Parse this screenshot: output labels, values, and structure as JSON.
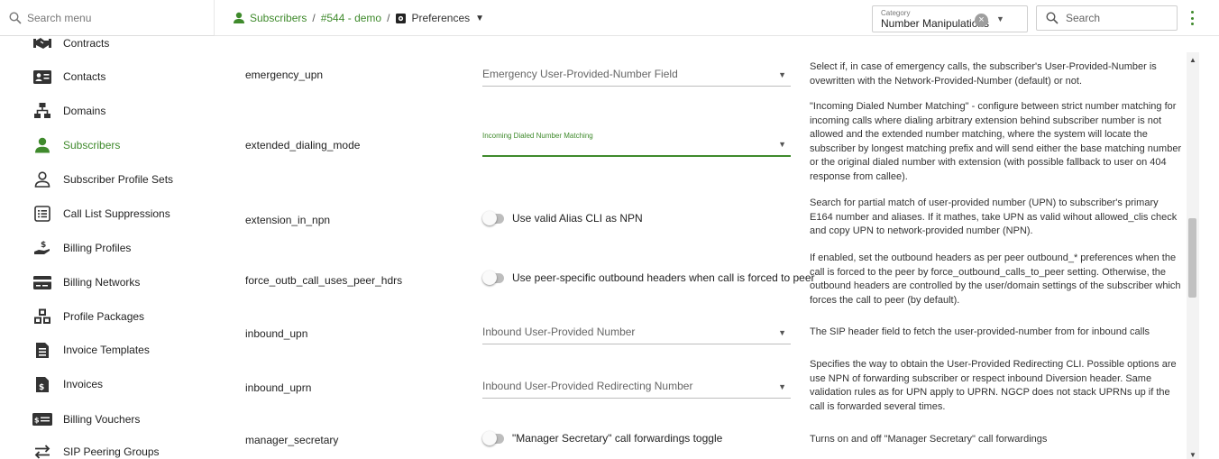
{
  "menu_search": {
    "placeholder": "Search menu"
  },
  "breadcrumb": {
    "items": [
      "Subscribers",
      "#544 - demo",
      "Preferences"
    ]
  },
  "category": {
    "label": "Category",
    "value": "Number Manipulations"
  },
  "search": {
    "placeholder": "Search"
  },
  "colors": {
    "accent": "#3f8a2c",
    "text": "#222222"
  },
  "sidebar": {
    "items": [
      {
        "label": "Contracts",
        "icon": "handshake-icon"
      },
      {
        "label": "Contacts",
        "icon": "contact-card-icon"
      },
      {
        "label": "Domains",
        "icon": "sitemap-icon"
      },
      {
        "label": "Subscribers",
        "icon": "person-icon",
        "active": true
      },
      {
        "label": "Subscriber Profile Sets",
        "icon": "person-outline-icon"
      },
      {
        "label": "Call List Suppressions",
        "icon": "list-box-icon"
      },
      {
        "label": "Billing Profiles",
        "icon": "hand-coin-icon"
      },
      {
        "label": "Billing Networks",
        "icon": "card-icon"
      },
      {
        "label": "Profile Packages",
        "icon": "cubes-icon"
      },
      {
        "label": "Invoice Templates",
        "icon": "document-icon"
      },
      {
        "label": "Invoices",
        "icon": "invoice-dollar-icon"
      },
      {
        "label": "Billing Vouchers",
        "icon": "voucher-icon"
      },
      {
        "label": "SIP Peering Groups",
        "icon": "swap-arrows-icon"
      }
    ]
  },
  "preferences": [
    {
      "name": "emergency_upn",
      "type": "select",
      "value": "Emergency User-Provided-Number Field",
      "description": "Select if, in case of emergency calls, the subscriber's User-Provided-Number is ovewritten with the Network-Provided-Number (default) or not."
    },
    {
      "name": "extended_dialing_mode",
      "type": "select",
      "focused": true,
      "value": "Incoming Dialed Number Matching",
      "description": "\"Incoming Dialed Number Matching\" - configure between strict number matching for incoming calls where dialing arbitrary extension behind subscriber number is not allowed and the extended number matching, where the system will locate the subscriber by longest matching prefix and will send either the base matching number or the original dialed number with extension (with possible fallback to user on 404 response from callee)."
    },
    {
      "name": "extension_in_npn",
      "type": "toggle",
      "value": "Use valid Alias CLI as NPN",
      "description": "Search for partial match of user-provided number (UPN) to subscriber's primary E164 number and aliases. If it mathes, take UPN as valid wihout allowed_clis check and copy UPN to network-provided number (NPN)."
    },
    {
      "name": "force_outb_call_uses_peer_hdrs",
      "type": "toggle",
      "value": "Use peer-specific outbound headers when call is forced to peer",
      "description": "If enabled, set the outbound headers as per peer outbound_* preferences when the call is forced to the peer by force_outbound_calls_to_peer setting. Otherwise, the outbound headers are controlled by the user/domain settings of the subscriber which forces the call to peer (by default)."
    },
    {
      "name": "inbound_upn",
      "type": "select",
      "value": "Inbound User-Provided Number",
      "description": "The SIP header field to fetch the user-provided-number from for inbound calls"
    },
    {
      "name": "inbound_uprn",
      "type": "select",
      "value": "Inbound User-Provided Redirecting Number",
      "description": "Specifies the way to obtain the User-Provided Redirecting CLI. Possible options are use NPN of forwarding subscriber or respect inbound Diversion header. Same validation rules as for UPN apply to UPRN. NGCP does not stack UPRNs up if the call is forwarded several times."
    },
    {
      "name": "manager_secretary",
      "type": "toggle",
      "value": "\"Manager Secretary\" call forwardings toggle",
      "description": "Turns on and off \"Manager Secretary\" call forwardings"
    }
  ]
}
